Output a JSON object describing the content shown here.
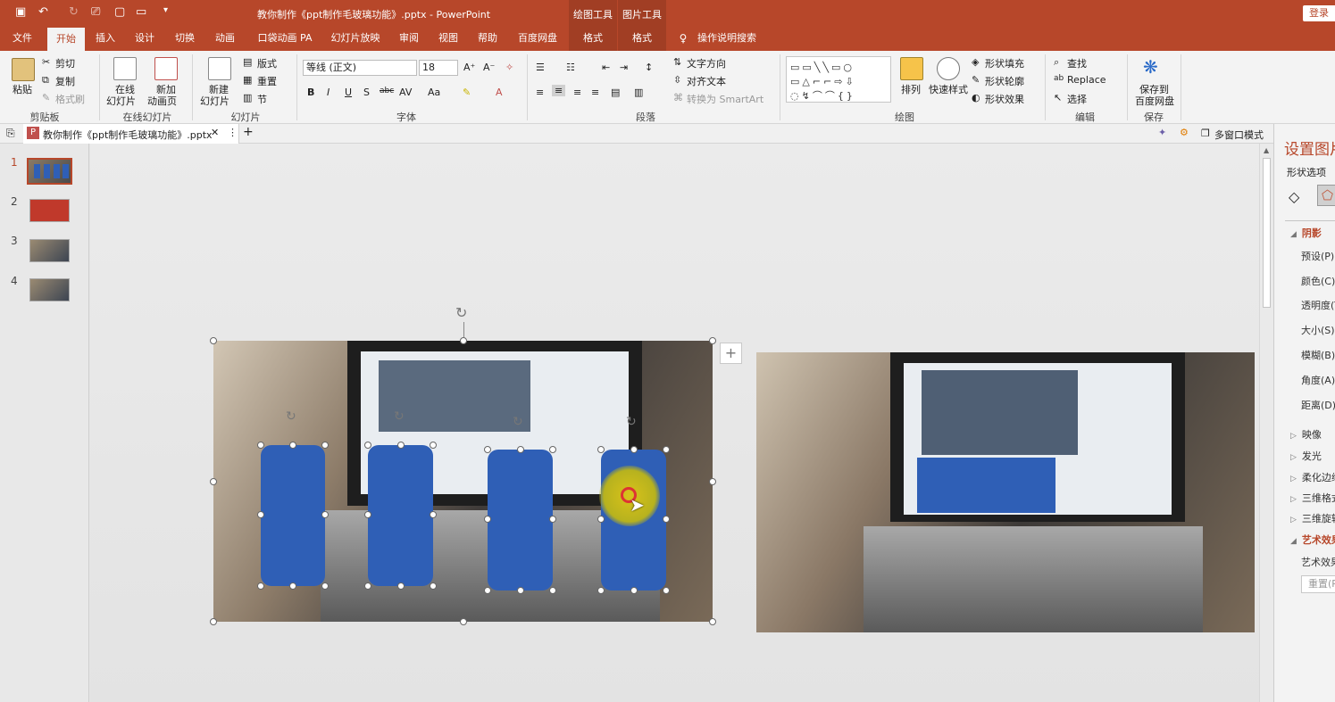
{
  "app": {
    "doc_title": "教你制作《ppt制作毛玻璃功能》.pptx  -  PowerPoint",
    "login": "登录"
  },
  "context_groups": [
    {
      "label": "绘图工具"
    },
    {
      "label": "图片工具"
    }
  ],
  "tabs": [
    {
      "label": "文件"
    },
    {
      "label": "开始"
    },
    {
      "label": "插入"
    },
    {
      "label": "设计"
    },
    {
      "label": "切换"
    },
    {
      "label": "动画"
    },
    {
      "label": "口袋动画 PA"
    },
    {
      "label": "幻灯片放映"
    },
    {
      "label": "审阅"
    },
    {
      "label": "视图"
    },
    {
      "label": "帮助"
    },
    {
      "label": "百度网盘"
    },
    {
      "label": "格式"
    },
    {
      "label": "格式"
    }
  ],
  "tell_me": "操作说明搜索",
  "ribbon": {
    "clipboard": {
      "paste": "粘贴",
      "cut": "剪切",
      "copy": "复制",
      "format_painter": "格式刷",
      "label": "剪贴板"
    },
    "online_slides": {
      "online": "在线",
      "slide": "幻灯片",
      "new_add": "新加",
      "anim_page": "动画页",
      "label": "在线幻灯片"
    },
    "slides": {
      "new": "新建",
      "slide": "幻灯片",
      "layout": "版式",
      "reset": "重置",
      "section": "节",
      "label": "幻灯片"
    },
    "font": {
      "name": "等线 (正文)",
      "size": "18",
      "label": "字体"
    },
    "paragraph": {
      "text_direction": "文字方向",
      "align_text": "对齐文本",
      "smartart": "转换为 SmartArt",
      "label": "段落"
    },
    "drawing": {
      "arrange": "排列",
      "quick_styles": "快速样式",
      "shape_fill": "形状填充",
      "shape_outline": "形状轮廓",
      "shape_effects": "形状效果",
      "label": "绘图"
    },
    "editing": {
      "find": "查找",
      "replace": "Replace",
      "select": "选择",
      "label": "编辑"
    },
    "save": {
      "save_to": "保存到",
      "baidu": "百度网盘",
      "label": "保存"
    }
  },
  "filetab": {
    "name": "教你制作《ppt制作毛玻璃功能》.pptx",
    "multiwindow": "多窗口模式"
  },
  "slides": [
    {
      "num": "1"
    },
    {
      "num": "2"
    },
    {
      "num": "3"
    },
    {
      "num": "4"
    }
  ],
  "pane": {
    "title": "设置图片",
    "subtitle": "形状选项",
    "sections": [
      {
        "label": "阴影"
      },
      {
        "label": "预设(P)"
      },
      {
        "label": "颜色(C)"
      },
      {
        "label": "透明度(T)"
      },
      {
        "label": "大小(S)"
      },
      {
        "label": "模糊(B)"
      },
      {
        "label": "角度(A)"
      },
      {
        "label": "距离(D)"
      },
      {
        "label": "映像"
      },
      {
        "label": "发光"
      },
      {
        "label": "柔化边缘"
      },
      {
        "label": "三维格式"
      },
      {
        "label": "三维旋转"
      },
      {
        "label": "艺术效果"
      },
      {
        "label": "艺术效果"
      },
      {
        "label": "重置(R)"
      }
    ]
  },
  "colors": {
    "accent": "#b7472a",
    "shape_blue": "#2f5fb6"
  }
}
